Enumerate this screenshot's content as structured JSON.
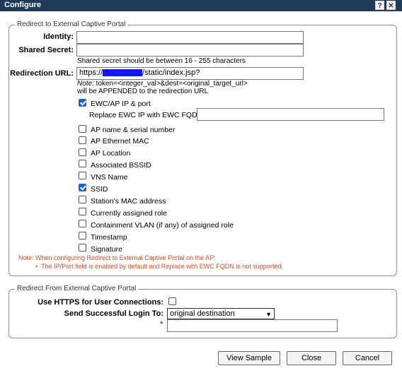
{
  "window": {
    "title": "Configure",
    "help_label": "?",
    "close_label": "✕"
  },
  "redirect_to": {
    "legend": "Redirect to External Captive Portal",
    "identity_label": "Identity:",
    "identity_value": "",
    "secret_label": "Shared Secret:",
    "secret_value": "",
    "secret_hint": "Shared secret should be between 16 - 255 characters",
    "url_label": "Redirection URL:",
    "url_prefix": "https://",
    "url_suffix": "/static/index.jsp?",
    "note_prefix": "Note:",
    "note_line1": " token=<integer_val>&dest=<original_target_url>",
    "note_line2": "will be APPENDED to the redirection URL",
    "options": [
      {
        "label": "EWC/AP IP & port",
        "checked": true
      },
      {
        "label": "AP name & serial number",
        "checked": false
      },
      {
        "label": "AP Ethernet MAC",
        "checked": false
      },
      {
        "label": "AP Location",
        "checked": false
      },
      {
        "label": "Associated BSSID",
        "checked": false
      },
      {
        "label": "VNS Name",
        "checked": false
      },
      {
        "label": "SSID",
        "checked": true
      },
      {
        "label": "Station's MAC address",
        "checked": false
      },
      {
        "label": "Currently assigned role",
        "checked": false
      },
      {
        "label": "Containment VLAN (if any) of assigned role",
        "checked": false
      },
      {
        "label": "Timestamp",
        "checked": false
      },
      {
        "label": "Signature",
        "checked": false
      }
    ],
    "replace_label": "Replace EWC IP with EWC FQDN:",
    "replace_value": "",
    "ap_note": "Note: When configuring Redirect to External Captive Portal on the AP:",
    "ap_note_bullet": "The IP/Port field is enabled by default and Replace with EWC FQDN is not supported."
  },
  "redirect_from": {
    "legend": "Redirect From External Captive Portal",
    "https_label": "Use HTTPS for User Connections:",
    "https_checked": false,
    "login_label": "Send Successful Login To:",
    "login_value": "original destination",
    "required_mark": "*",
    "extra_value": ""
  },
  "buttons": {
    "view_sample": "View Sample",
    "close": "Close",
    "cancel": "Cancel"
  }
}
